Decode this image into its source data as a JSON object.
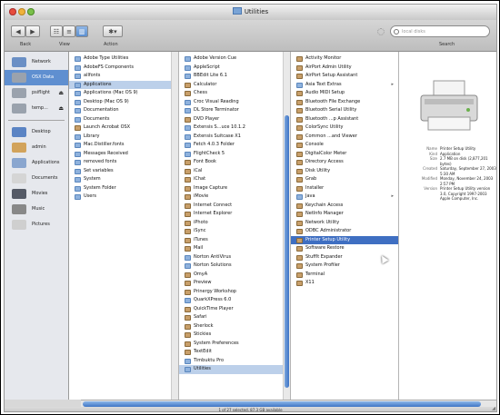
{
  "window": {
    "title": "Utilities"
  },
  "toolbar": {
    "back": "◀",
    "forward": "▶",
    "view_icon": "☷",
    "view_list": "≡",
    "view_column": "▥",
    "action": "✱▾",
    "back_label": "Back",
    "view_label": "View",
    "action_label": "Action",
    "search_placeholder": "local disks",
    "search_label": "Search"
  },
  "sidebar": {
    "devices": [
      {
        "label": "Network",
        "icon": "globe-icon",
        "color": "#6a8fc5"
      },
      {
        "label": "OSX Data",
        "icon": "harddisk-icon",
        "color": "#9aa2ad",
        "selected": true
      },
      {
        "label": "psiflight",
        "icon": "harddisk-icon",
        "color": "#9aa2ad",
        "eject": "⏏"
      },
      {
        "label": "temp...",
        "icon": "harddisk-icon",
        "color": "#9aa2ad",
        "eject": "⏏"
      }
    ],
    "places": [
      {
        "label": "Desktop",
        "icon": "desktop-icon",
        "color": "#5b84c4"
      },
      {
        "label": "admin",
        "icon": "home-icon",
        "color": "#d2a35b"
      },
      {
        "label": "Applications",
        "icon": "applications-icon",
        "color": "#8aa6cf"
      },
      {
        "label": "Documents",
        "icon": "documents-icon",
        "color": "#d5d5d5"
      },
      {
        "label": "Movies",
        "icon": "movies-icon",
        "color": "#555a66"
      },
      {
        "label": "Music",
        "icon": "music-icon",
        "color": "#888"
      },
      {
        "label": "Pictures",
        "icon": "pictures-icon",
        "color": "#cfcfcf"
      }
    ]
  },
  "columns": {
    "col1": [
      {
        "label": "Adobe Type Utilities",
        "kind": "folder",
        "arrow": "▸"
      },
      {
        "label": "AdobeFS Components",
        "kind": "folder",
        "arrow": "▸"
      },
      {
        "label": "allfonts",
        "kind": "folder",
        "arrow": "▸"
      },
      {
        "label": "Applications",
        "kind": "folder",
        "arrow": "▸",
        "state": "hl"
      },
      {
        "label": "Applications (Mac OS 9)",
        "kind": "folder",
        "arrow": "▸"
      },
      {
        "label": "Desktop (Mac OS 9)",
        "kind": "folder",
        "arrow": "▸"
      },
      {
        "label": "Documentation",
        "kind": "folder",
        "arrow": "▸"
      },
      {
        "label": "Documents",
        "kind": "folder",
        "arrow": "▸"
      },
      {
        "label": "Launch Acrobat OSX",
        "kind": "app",
        "arrow": ""
      },
      {
        "label": "Library",
        "kind": "folder",
        "arrow": "▸"
      },
      {
        "label": "Mac.Distiller.fonts",
        "kind": "folder",
        "arrow": "▸"
      },
      {
        "label": "Messages Received",
        "kind": "folder",
        "arrow": "▸"
      },
      {
        "label": "removed fonts",
        "kind": "folder",
        "arrow": "▸"
      },
      {
        "label": "Set variables",
        "kind": "folder",
        "arrow": "▸"
      },
      {
        "label": "System",
        "kind": "folder",
        "arrow": "▸"
      },
      {
        "label": "System Folder",
        "kind": "folder",
        "arrow": "▸"
      },
      {
        "label": "Users",
        "kind": "folder",
        "arrow": "▸"
      }
    ],
    "col2": [
      {
        "label": "Adobe Version Cue",
        "kind": "folder",
        "arrow": "▸"
      },
      {
        "label": "AppleScript",
        "kind": "folder",
        "arrow": "▸"
      },
      {
        "label": "BBEdit Lite 6.1",
        "kind": "folder",
        "arrow": "▸"
      },
      {
        "label": "Calculator",
        "kind": "app",
        "arrow": ""
      },
      {
        "label": "Chess",
        "kind": "app",
        "arrow": ""
      },
      {
        "label": "Croc Visual Reading",
        "kind": "folder",
        "arrow": "▸"
      },
      {
        "label": "DL Store Terminator",
        "kind": "folder",
        "arrow": "▸"
      },
      {
        "label": "DVD Player",
        "kind": "app",
        "arrow": ""
      },
      {
        "label": "Extensis S...uce 10.1.2",
        "kind": "folder",
        "arrow": "▸"
      },
      {
        "label": "Extensis Suitcase X1",
        "kind": "folder",
        "arrow": "▸"
      },
      {
        "label": "Fetch 4.0.3 Folder",
        "kind": "folder",
        "arrow": "▸"
      },
      {
        "label": "FlightCheck 5",
        "kind": "folder",
        "arrow": "▸"
      },
      {
        "label": "Font Book",
        "kind": "app",
        "arrow": ""
      },
      {
        "label": "iCal",
        "kind": "app",
        "arrow": ""
      },
      {
        "label": "iChat",
        "kind": "app",
        "arrow": ""
      },
      {
        "label": "Image Capture",
        "kind": "app",
        "arrow": ""
      },
      {
        "label": "iMovie",
        "kind": "app",
        "arrow": ""
      },
      {
        "label": "Internet Connect",
        "kind": "app",
        "arrow": ""
      },
      {
        "label": "Internet Explorer",
        "kind": "app",
        "arrow": ""
      },
      {
        "label": "iPhoto",
        "kind": "app",
        "arrow": ""
      },
      {
        "label": "iSync",
        "kind": "app",
        "arrow": ""
      },
      {
        "label": "iTunes",
        "kind": "app",
        "arrow": ""
      },
      {
        "label": "Mail",
        "kind": "app",
        "arrow": ""
      },
      {
        "label": "Norton AntiVirus",
        "kind": "folder",
        "arrow": "▸"
      },
      {
        "label": "Norton Solutions",
        "kind": "folder",
        "arrow": "▸"
      },
      {
        "label": "OmyA",
        "kind": "app",
        "arrow": ""
      },
      {
        "label": "Preview",
        "kind": "app",
        "arrow": ""
      },
      {
        "label": "Prinergy Workshop",
        "kind": "app",
        "arrow": ""
      },
      {
        "label": "QuarkXPress 6.0",
        "kind": "folder",
        "arrow": "▸"
      },
      {
        "label": "QuickTime Player",
        "kind": "app",
        "arrow": ""
      },
      {
        "label": "Safari",
        "kind": "app",
        "arrow": ""
      },
      {
        "label": "Sherlock",
        "kind": "app",
        "arrow": ""
      },
      {
        "label": "Stickies",
        "kind": "app",
        "arrow": ""
      },
      {
        "label": "System Preferences",
        "kind": "app",
        "arrow": ""
      },
      {
        "label": "TextEdit",
        "kind": "app",
        "arrow": ""
      },
      {
        "label": "Timbuktu Pro",
        "kind": "folder",
        "arrow": "▸"
      },
      {
        "label": "Utilities",
        "kind": "folder",
        "arrow": "▸",
        "state": "hl"
      }
    ],
    "col3": [
      {
        "label": "Activity Monitor",
        "kind": "app"
      },
      {
        "label": "AirPort Admin Utility",
        "kind": "app"
      },
      {
        "label": "AirPort Setup Assistant",
        "kind": "app"
      },
      {
        "label": "Asia Text Extras",
        "kind": "folder",
        "arrow": "▸"
      },
      {
        "label": "Audio MIDI Setup",
        "kind": "app"
      },
      {
        "label": "Bluetooth File Exchange",
        "kind": "app"
      },
      {
        "label": "Bluetooth Serial Utility",
        "kind": "app"
      },
      {
        "label": "Bluetooth ...p Assistant",
        "kind": "app"
      },
      {
        "label": "ColorSync Utility",
        "kind": "app"
      },
      {
        "label": "Common ...and Viewer",
        "kind": "app"
      },
      {
        "label": "Console",
        "kind": "app"
      },
      {
        "label": "DigitalColor Meter",
        "kind": "app"
      },
      {
        "label": "Directory Access",
        "kind": "app"
      },
      {
        "label": "Disk Utility",
        "kind": "app"
      },
      {
        "label": "Grab",
        "kind": "app"
      },
      {
        "label": "Installer",
        "kind": "app"
      },
      {
        "label": "Java",
        "kind": "folder",
        "arrow": "▸"
      },
      {
        "label": "Keychain Access",
        "kind": "app"
      },
      {
        "label": "NetInfo Manager",
        "kind": "app"
      },
      {
        "label": "Network Utility",
        "kind": "app"
      },
      {
        "label": "ODBC Administrator",
        "kind": "app"
      },
      {
        "label": "Printer Setup Utility",
        "kind": "app",
        "state": "sel"
      },
      {
        "label": "Software Restore",
        "kind": "app"
      },
      {
        "label": "StuffIt Expander",
        "kind": "app"
      },
      {
        "label": "System Profiler",
        "kind": "app"
      },
      {
        "label": "Terminal",
        "kind": "app"
      },
      {
        "label": "X11",
        "kind": "app"
      }
    ]
  },
  "preview": {
    "image": "printer-icon",
    "fields": [
      {
        "k": "Name",
        "v": "Printer Setup Utility"
      },
      {
        "k": "Kind",
        "v": "Application"
      },
      {
        "k": "Size",
        "v": "2.7 MB on disk (2,877,201 bytes)"
      },
      {
        "k": "Created",
        "v": "Saturday, September 27, 2003 5:30 AM"
      },
      {
        "k": "Modified",
        "v": "Monday, November 24, 2003 2:57 PM"
      },
      {
        "k": "Version",
        "v": "Printer Setup Utility version 3.0, Copyright 1997-2003 Apple Computer, Inc."
      }
    ]
  },
  "status": {
    "text": "1 of 27 selected, 87.3 GB available"
  }
}
